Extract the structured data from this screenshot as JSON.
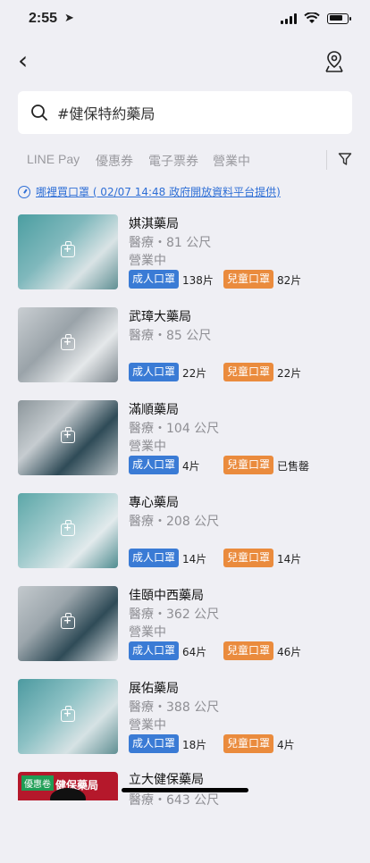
{
  "status": {
    "time": "2:55"
  },
  "nav": {
    "back": "‹"
  },
  "search": {
    "query": "#健保特約藥局"
  },
  "tabs": [
    "LINE Pay",
    "優惠券",
    "電子票券",
    "營業中"
  ],
  "info": {
    "text": "哪裡買口罩 ( 02/07 14:48 政府開放資料平台提供)"
  },
  "labels": {
    "adult": "成人口罩",
    "child": "兒童口罩"
  },
  "stores": [
    {
      "name": "娸淇藥局",
      "meta": "醫療・81 公尺",
      "status": "營業中",
      "adult": "138片",
      "child": "82片"
    },
    {
      "name": "武璋大藥局",
      "meta": "醫療・85 公尺",
      "status": "",
      "adult": "22片",
      "child": "22片"
    },
    {
      "name": "滿順藥局",
      "meta": "醫療・104 公尺",
      "status": "營業中",
      "adult": "4片",
      "child": "已售罄"
    },
    {
      "name": "專心藥局",
      "meta": "醫療・208 公尺",
      "status": "",
      "adult": "14片",
      "child": "14片"
    },
    {
      "name": "佳頤中西藥局",
      "meta": "醫療・362 公尺",
      "status": "營業中",
      "adult": "64片",
      "child": "46片"
    },
    {
      "name": "展佑藥局",
      "meta": "醫療・388 公尺",
      "status": "營業中",
      "adult": "18片",
      "child": "4片"
    }
  ],
  "last_store": {
    "name": "立大健保藥局",
    "meta": "醫療・643 公尺",
    "coupon_tag": "優惠卷",
    "brand": "健保藥局"
  },
  "colors": {
    "adult": "#3a7bd5",
    "child": "#ea8b3d",
    "link": "#2f6fd6"
  }
}
